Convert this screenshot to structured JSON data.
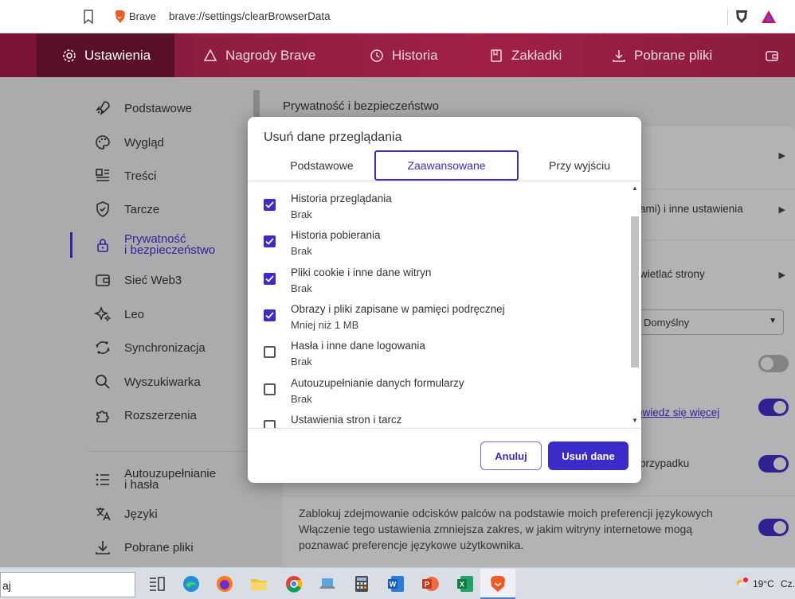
{
  "address_bar": {
    "site_name": "Brave",
    "url": "brave://settings/clearBrowserData"
  },
  "nav": {
    "items": [
      {
        "label": "Ustawienia",
        "icon": "gear-icon"
      },
      {
        "label": "Nagrody Brave",
        "icon": "rewards-triangle-icon"
      },
      {
        "label": "Historia",
        "icon": "history-icon"
      },
      {
        "label": "Zakładki",
        "icon": "bookmark-icon"
      },
      {
        "label": "Pobrane pliki",
        "icon": "download-icon"
      }
    ]
  },
  "sidebar": {
    "items": [
      {
        "label": "Podstawowe",
        "icon": "rocket-icon"
      },
      {
        "label": "Wygląd",
        "icon": "palette-icon"
      },
      {
        "label": "Treści",
        "icon": "content-icon"
      },
      {
        "label": "Tarcze",
        "icon": "shield-icon"
      },
      {
        "label_line1": "Prywatność",
        "label_line2": "i bezpieczeństwo",
        "icon": "lock-icon"
      },
      {
        "label": "Sieć Web3",
        "icon": "wallet-icon"
      },
      {
        "label": "Leo",
        "icon": "sparkle-icon"
      },
      {
        "label": "Synchronizacja",
        "icon": "sync-icon"
      },
      {
        "label": "Wyszukiwarka",
        "icon": "search-icon"
      },
      {
        "label": "Rozszerzenia",
        "icon": "puzzle-icon"
      },
      {
        "label_line1": "Autouzupełnianie",
        "label_line2": "i hasła",
        "icon": "list-icon"
      },
      {
        "label": "Języki",
        "icon": "translate-icon"
      },
      {
        "label": "Pobrane pliki",
        "icon": "download-icon"
      }
    ]
  },
  "main": {
    "heading": "Prywatność i bezpieczeństwo",
    "row2_fragment": "ami) i inne ustawienia",
    "row3_fragment": "wietlać strony",
    "select_value": "Domyślny",
    "link_fragment": "owiedz się więcej",
    "row_fragment_case": "przypadku",
    "para_line1": "Zablokuj zdejmowanie odcisków palców na podstawie moich preferencji językowych",
    "para_line2": "Włączenie tego ustawienia zmniejsza zakres, w jakim witryny internetowe mogą",
    "para_line3": "poznawać preferencje językowe użytkownika."
  },
  "dialog": {
    "title": "Usuń dane przeglądania",
    "tabs": [
      "Podstawowe",
      "Zaawansowane",
      "Przy wyjściu"
    ],
    "selected_tab": "Zaawansowane",
    "entries": [
      {
        "label": "Historia przeglądania",
        "sub": "Brak",
        "checked": true
      },
      {
        "label": "Historia pobierania",
        "sub": "Brak",
        "checked": true
      },
      {
        "label": "Pliki cookie i inne dane witryn",
        "sub": "Brak",
        "checked": true
      },
      {
        "label": "Obrazy i pliki zapisane w pamięci podręcznej",
        "sub": "Mniej niż 1 MB",
        "checked": true
      },
      {
        "label": "Hasła i inne dane logowania",
        "sub": "Brak",
        "checked": false
      },
      {
        "label": "Autouzupełnianie danych formularzy",
        "sub": "Brak",
        "checked": false
      },
      {
        "label": "Ustawienia stron i tarcz",
        "sub": "",
        "checked": false
      }
    ],
    "cancel_label": "Anuluj",
    "delete_label": "Usuń dane"
  },
  "taskbar": {
    "search_text": "aj",
    "temperature": "19°C",
    "lang": "Cz."
  },
  "colors": {
    "accent": "#3b2cc9",
    "nav_bg": "#8e1d40"
  }
}
